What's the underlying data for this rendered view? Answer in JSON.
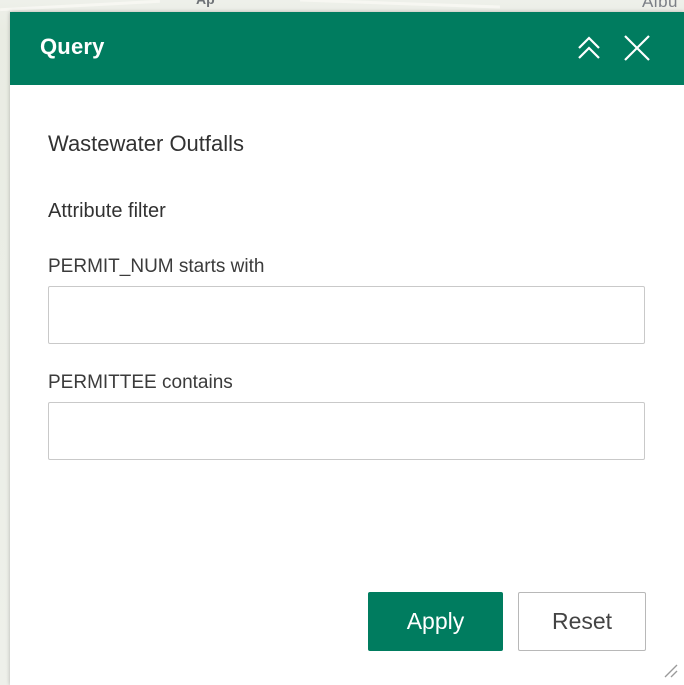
{
  "map": {
    "label_right": "Albu",
    "label_left": "Ap"
  },
  "widget": {
    "title": "Query",
    "collapse_icon": "double-chevron-up-icon",
    "close_icon": "close-icon",
    "accent_color": "#007c5f"
  },
  "layer": {
    "name": "Wastewater Outfalls"
  },
  "filter": {
    "section_title": "Attribute filter",
    "fields": [
      {
        "label": "PERMIT_NUM starts with",
        "value": "",
        "placeholder": ""
      },
      {
        "label": "PERMITTEE contains",
        "value": "",
        "placeholder": ""
      }
    ]
  },
  "actions": {
    "apply_label": "Apply",
    "reset_label": "Reset"
  }
}
